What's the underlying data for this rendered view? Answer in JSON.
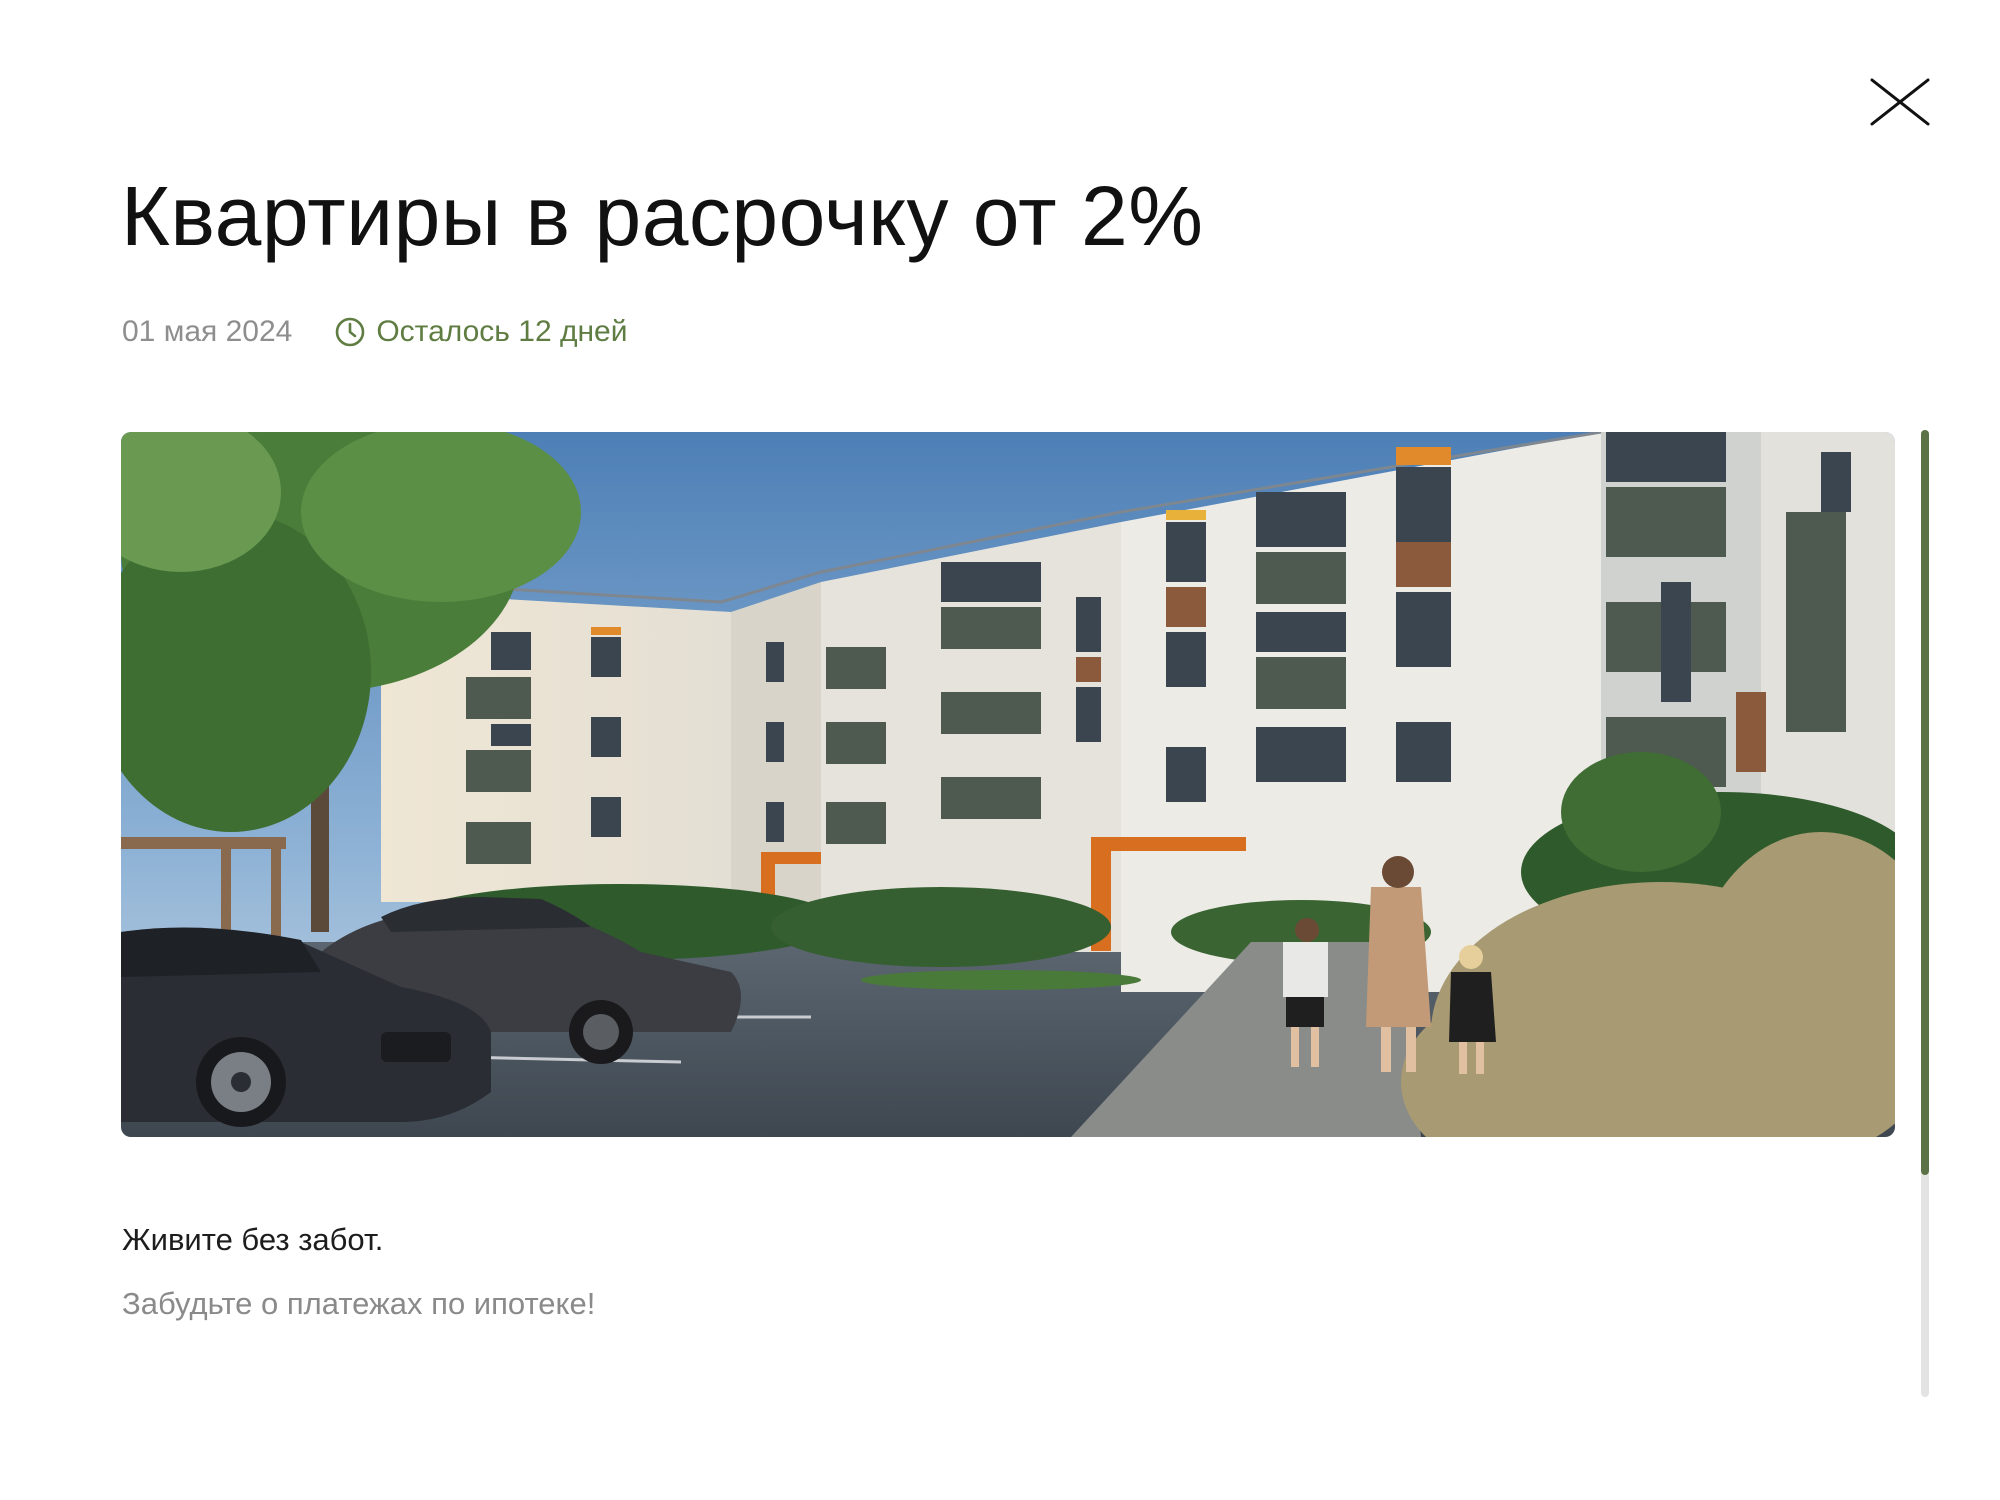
{
  "modal": {
    "title": "Квартиры в расрочку от 2%",
    "date": "01 мая 2024",
    "remaining": "Осталось 12 дней",
    "lead": "Живите без забот.",
    "body": "Забудьте о платежах по ипотеке!"
  },
  "icons": {
    "close": "close-icon",
    "clock": "clock-icon"
  },
  "scroll": {
    "position_fraction": 0.0,
    "visible_fraction": 0.77
  },
  "colors": {
    "accent_green": "#5f7d43",
    "scrollbar_thumb": "#5a7246",
    "text_primary": "#111111",
    "text_muted": "#8e8e8e"
  }
}
